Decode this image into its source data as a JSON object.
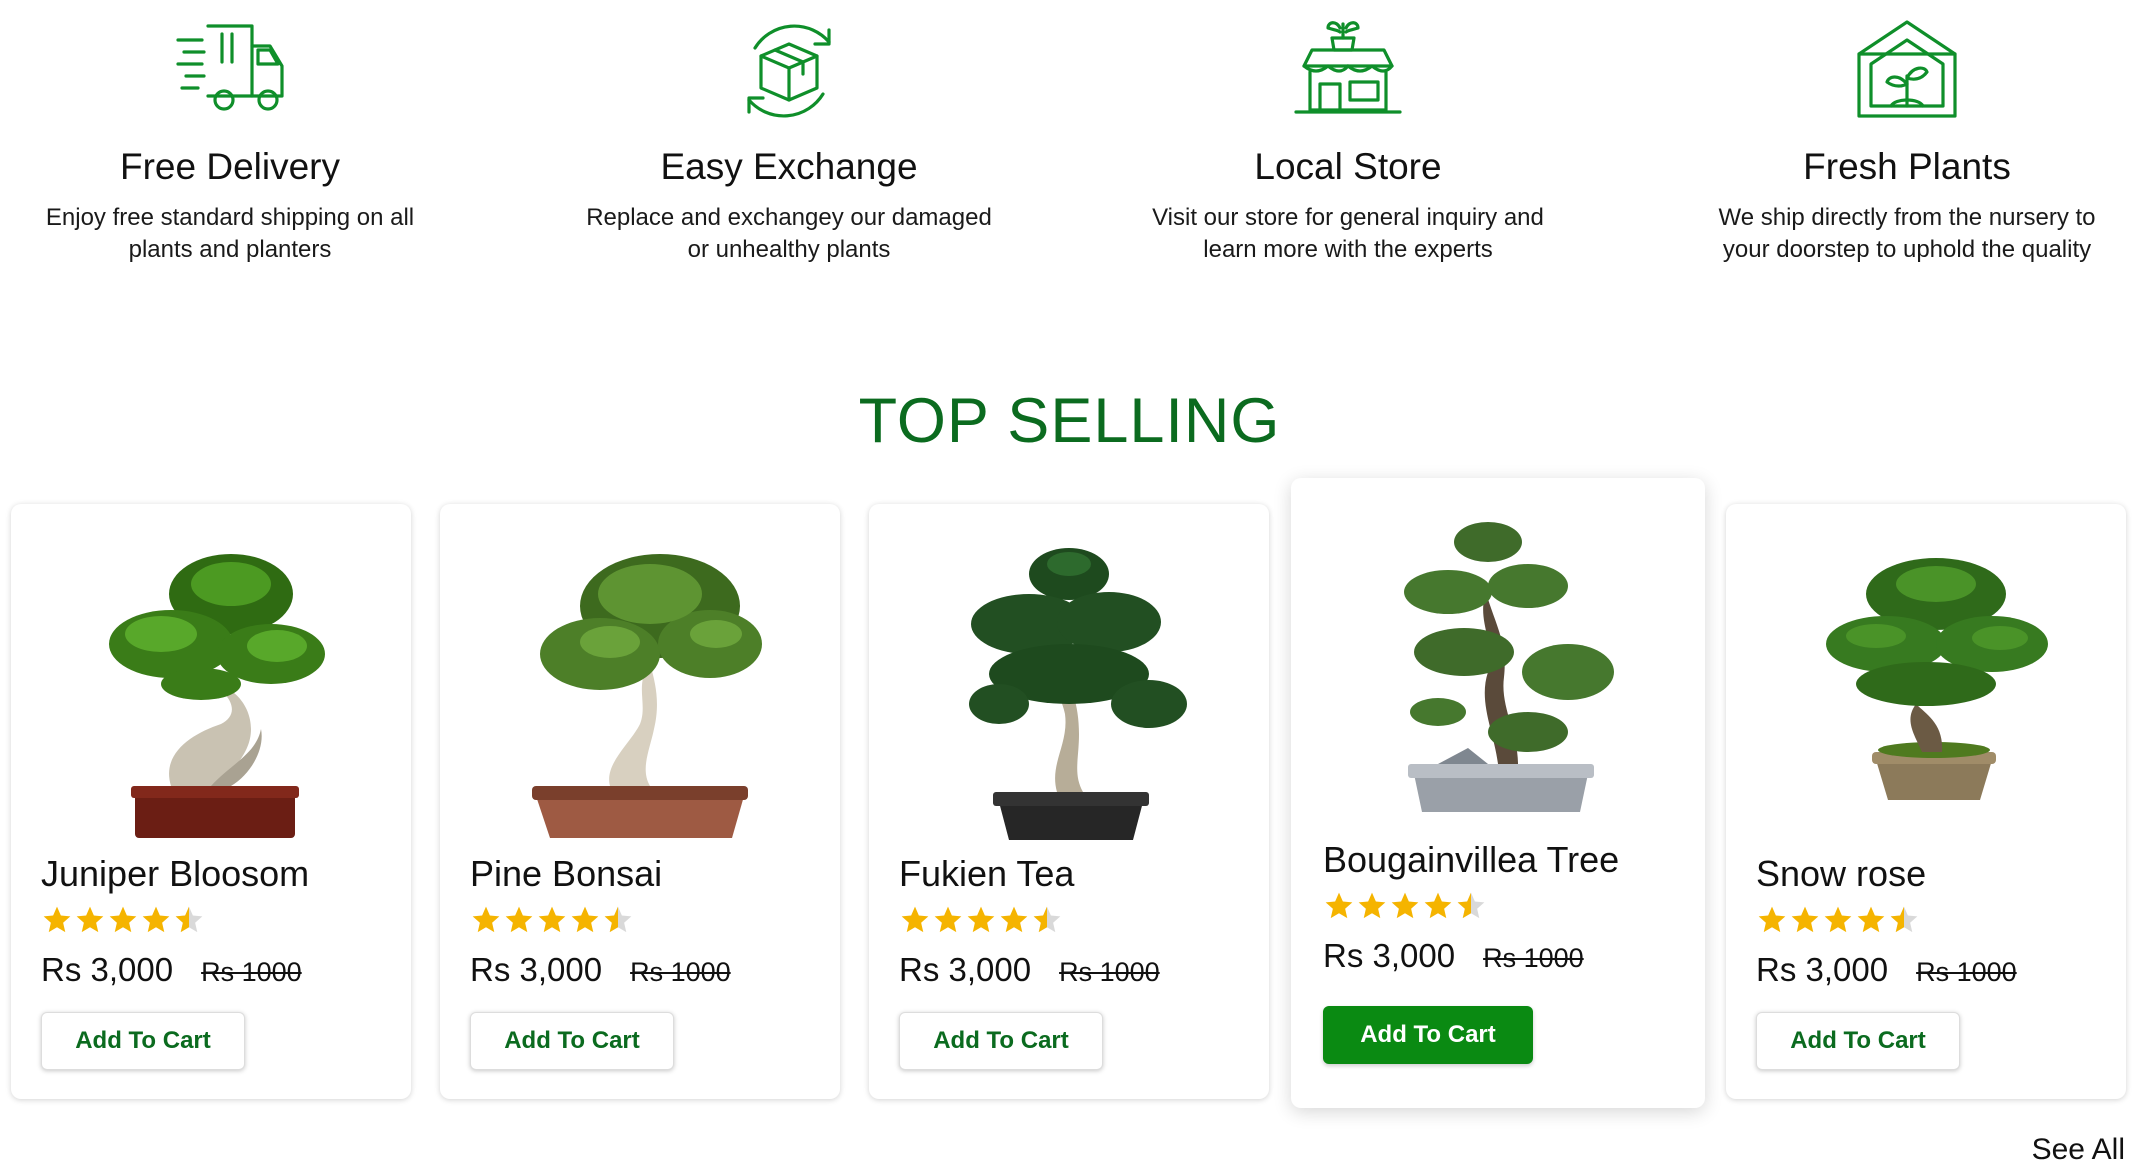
{
  "features": [
    {
      "icon": "delivery-truck-icon",
      "title": "Free Delivery",
      "description": "Enjoy free standard shipping on all plants and planters"
    },
    {
      "icon": "exchange-box-icon",
      "title": "Easy Exchange",
      "description": "Replace and exchangey our damaged or unhealthy plants"
    },
    {
      "icon": "local-store-icon",
      "title": "Local Store",
      "description": "Visit our store for general inquiry and learn more with the experts"
    },
    {
      "icon": "greenhouse-plant-icon",
      "title": "Fresh Plants",
      "description": "We ship directly from the nursery to your doorstep to uphold the quality"
    }
  ],
  "section_title": "TOP SELLING",
  "products": [
    {
      "name": "Juniper Bloosom",
      "rating": 4.5,
      "price": "Rs 3,000",
      "old_price": "Rs 1000",
      "button": "Add To Cart"
    },
    {
      "name": "Pine Bonsai",
      "rating": 4.5,
      "price": "Rs 3,000",
      "old_price": "Rs 1000",
      "button": "Add To Cart"
    },
    {
      "name": "Fukien Tea",
      "rating": 4.5,
      "price": "Rs 3,000",
      "old_price": "Rs 1000",
      "button": "Add To Cart"
    },
    {
      "name": "Bougainvillea Tree",
      "rating": 4.5,
      "price": "Rs 3,000",
      "old_price": "Rs 1000",
      "button": "Add To Cart"
    },
    {
      "name": "Snow rose",
      "rating": 4.5,
      "price": "Rs 3,000",
      "old_price": "Rs 1000",
      "button": "Add To Cart"
    }
  ],
  "see_all": "See All",
  "colors": {
    "brand_green": "#0b6b1f",
    "button_green": "#0a8a12",
    "star": "#f5b400",
    "icon_green": "#0f8f2a"
  }
}
